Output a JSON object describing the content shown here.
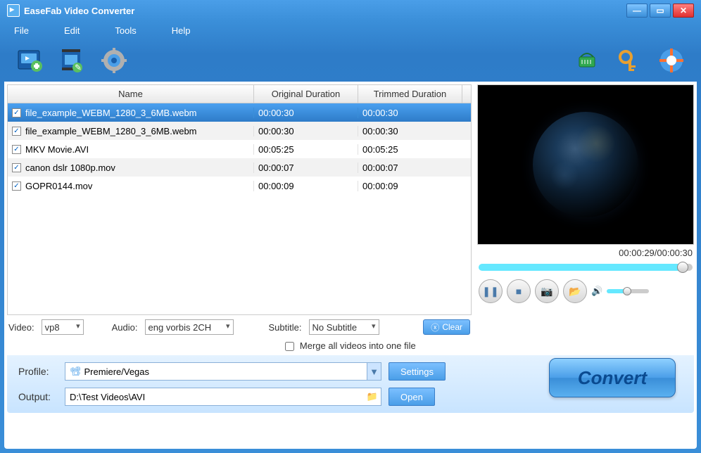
{
  "title": "EaseFab Video Converter",
  "menu": {
    "file": "File",
    "edit": "Edit",
    "tools": "Tools",
    "help": "Help"
  },
  "table": {
    "headers": {
      "name": "Name",
      "original": "Original Duration",
      "trimmed": "Trimmed Duration"
    },
    "rows": [
      {
        "name": "file_example_WEBM_1280_3_6MB.webm",
        "orig": "00:00:30",
        "trim": "00:00:30",
        "selected": true
      },
      {
        "name": "file_example_WEBM_1280_3_6MB.webm",
        "orig": "00:00:30",
        "trim": "00:00:30",
        "selected": false
      },
      {
        "name": "MKV Movie.AVI",
        "orig": "00:05:25",
        "trim": "00:05:25",
        "selected": false
      },
      {
        "name": "canon dslr 1080p.mov",
        "orig": "00:00:07",
        "trim": "00:00:07",
        "selected": false
      },
      {
        "name": "GOPR0144.mov",
        "orig": "00:00:09",
        "trim": "00:00:09",
        "selected": false
      }
    ]
  },
  "preview": {
    "time": "00:00:29/00:00:30"
  },
  "streams": {
    "video_label": "Video:",
    "video_value": "vp8",
    "audio_label": "Audio:",
    "audio_value": "eng vorbis 2CH",
    "subtitle_label": "Subtitle:",
    "subtitle_value": "No Subtitle",
    "clear": "Clear"
  },
  "merge": {
    "label": "Merge all videos into one file"
  },
  "profile": {
    "label": "Profile:",
    "value": "Premiere/Vegas",
    "settings": "Settings"
  },
  "output": {
    "label": "Output:",
    "value": "D:\\Test Videos\\AVI",
    "open": "Open"
  },
  "convert": "Convert"
}
